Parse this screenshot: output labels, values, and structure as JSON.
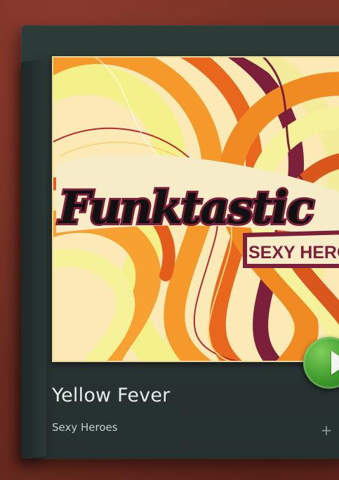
{
  "track": {
    "title": "Yellow Fever",
    "artist": "Sexy Heroes"
  },
  "artwork": {
    "logo_main": "Funktastic",
    "logo_sub": "SEXY HEROES"
  },
  "controls": {
    "add_symbol": "+",
    "play_icon": "play-icon"
  },
  "colors": {
    "background": "#6e2d22",
    "card": "#2a3634",
    "play_green": "#3e9b2c",
    "title_text": "#e8ebea"
  }
}
